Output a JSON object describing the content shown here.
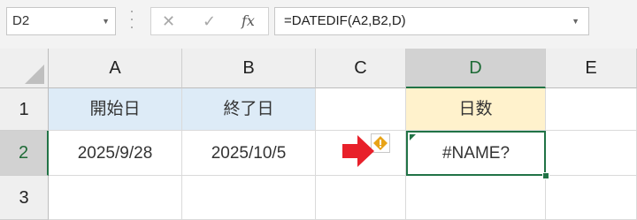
{
  "name_box": {
    "value": "D2"
  },
  "formula_bar": {
    "cancel_icon": "cancel-icon",
    "enter_icon": "check-icon",
    "fx_label": "fx",
    "formula": "=DATEDIF(A2,B2,D)"
  },
  "columns": [
    "A",
    "B",
    "C",
    "D",
    "E"
  ],
  "rows": [
    "1",
    "2",
    "3"
  ],
  "cells": {
    "A1": "開始日",
    "B1": "終了日",
    "D1": "日数",
    "A2": "2025/9/28",
    "B2": "2025/10/5",
    "D2": "#NAME?"
  },
  "colors": {
    "header_fill": "#ddebf7",
    "result_header_fill": "#fff2cc",
    "selection": "#217346",
    "arrow": "#e8202a",
    "warning": "#e8a317"
  },
  "annotations": {
    "arrow_icon": "red-arrow-icon",
    "error_icon": "error-warning-icon"
  }
}
